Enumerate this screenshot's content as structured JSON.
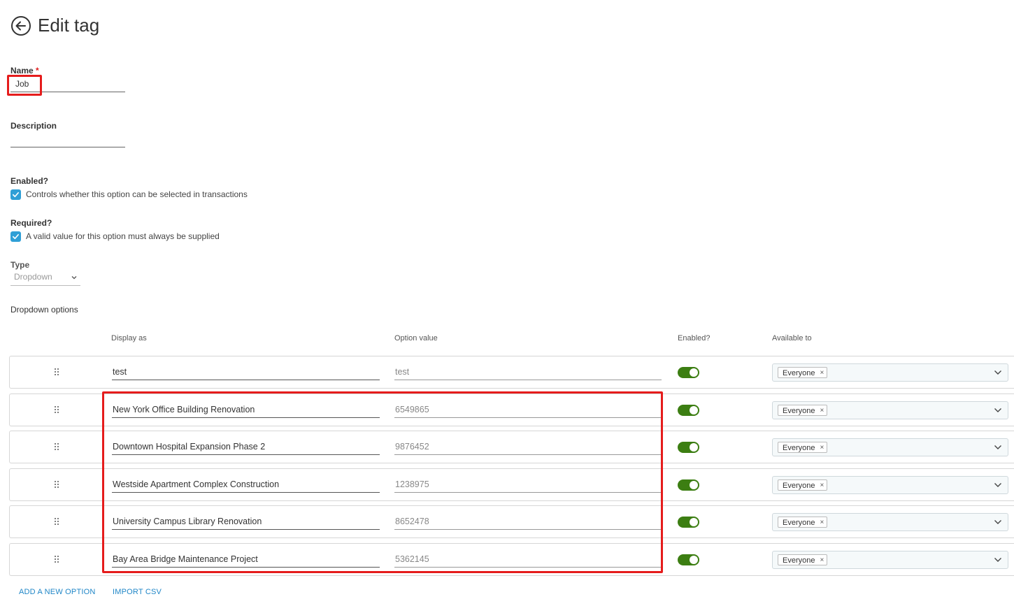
{
  "header": {
    "title": "Edit tag",
    "back_icon": "arrow-left-circle-icon"
  },
  "form": {
    "name": {
      "label": "Name",
      "required_mark": "*",
      "value": "Job"
    },
    "description": {
      "label": "Description",
      "value": ""
    },
    "enabled": {
      "label": "Enabled?",
      "checkbox_text": "Controls whether this option can be selected in transactions",
      "checked": true
    },
    "required": {
      "label": "Required?",
      "checkbox_text": "A valid value for this option must always be supplied",
      "checked": true
    },
    "type": {
      "label": "Type",
      "value": "Dropdown"
    }
  },
  "dropdown_options": {
    "section_label": "Dropdown options",
    "columns": {
      "display_as": "Display as",
      "option_value": "Option value",
      "enabled": "Enabled?",
      "available_to": "Available to"
    },
    "rows": [
      {
        "display": "test",
        "value": "test",
        "enabled": true,
        "available": "Everyone"
      },
      {
        "display": "New York Office Building Renovation",
        "value": "6549865",
        "enabled": true,
        "available": "Everyone"
      },
      {
        "display": "Downtown Hospital Expansion Phase 2",
        "value": "9876452",
        "enabled": true,
        "available": "Everyone"
      },
      {
        "display": "Westside Apartment Complex Construction",
        "value": "1238975",
        "enabled": true,
        "available": "Everyone"
      },
      {
        "display": "University Campus Library Renovation",
        "value": "8652478",
        "enabled": true,
        "available": "Everyone"
      },
      {
        "display": "Bay Area Bridge Maintenance Project",
        "value": "5362145",
        "enabled": true,
        "available": "Everyone"
      }
    ],
    "chip_remove": "×"
  },
  "actions": {
    "add_option": "ADD A NEW OPTION",
    "import_csv": "IMPORT CSV"
  },
  "colors": {
    "accent": "#2f9fd6",
    "toggle_on": "#3c7e12",
    "highlight": "#e51c1c",
    "link": "#1f86c7"
  }
}
